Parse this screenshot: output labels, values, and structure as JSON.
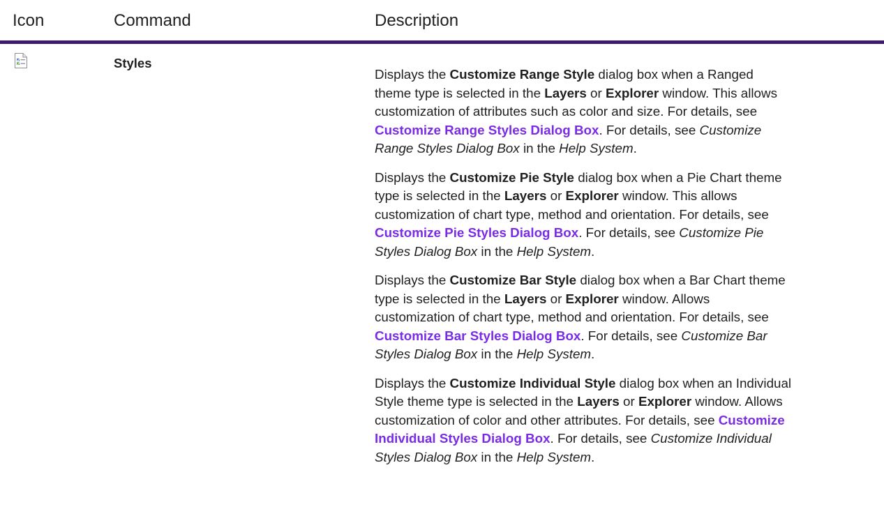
{
  "header": {
    "icon_col": "Icon",
    "command_col": "Command",
    "description_col": "Description"
  },
  "row": {
    "icon": "styles-list-icon",
    "command": "Styles",
    "descriptions": [
      {
        "lines": [
          [
            "Displays the ",
            "Customize Range Style",
            " dialog box when a Ranged"
          ],
          [
            "theme type is selected in the ",
            "Layers",
            " or ",
            "Explorer",
            " window. This allows"
          ],
          [
            "customization of attributes such as color and size. For details, see"
          ],
          [
            "Customize Range Styles Dialog Box",
            ". For details, see ",
            "Customize"
          ],
          [
            "Range Styles Dialog Box",
            " in the ",
            "Help System",
            "."
          ]
        ]
      },
      {
        "lines": [
          [
            "Displays the ",
            "Customize Pie Style",
            " dialog box when a Pie Chart theme"
          ],
          [
            "type is selected in the ",
            "Layers",
            " or ",
            "Explorer",
            " window. This allows"
          ],
          [
            "customization of chart type, method and orientation. For details, see"
          ],
          [
            "Customize Pie Styles Dialog Box",
            ". For details, see ",
            "Customize Pie"
          ],
          [
            "Styles Dialog Box",
            " in the ",
            "Help System",
            "."
          ]
        ]
      },
      {
        "lines": [
          [
            "Displays the ",
            "Customize Bar Style",
            " dialog box when a Bar Chart theme"
          ],
          [
            "type is selected in the ",
            "Layers",
            " or ",
            "Explorer",
            " window. Allows"
          ],
          [
            "customization of chart type, method and orientation. For details, see"
          ],
          [
            "Customize Bar Styles Dialog Box",
            ". For details, see ",
            "Customize Bar"
          ],
          [
            "Styles Dialog Box",
            " in the ",
            "Help System",
            "."
          ]
        ]
      },
      {
        "lines": [
          [
            "Displays the ",
            "Customize Individual Style",
            " dialog box when an Individual"
          ],
          [
            "Style theme type is selected in the ",
            "Layers",
            " or ",
            "Explorer",
            " window. Allows"
          ],
          [
            "customization of  color and other attributes. For details, see ",
            "Customize"
          ],
          [
            "Individual Styles Dialog Box",
            ". For details, see ",
            "Customize Individual"
          ],
          [
            "Styles Dialog Box",
            " in the ",
            "Help System",
            "."
          ]
        ]
      }
    ]
  },
  "colors": {
    "link": "#7a2be6",
    "rule": "#3d1a6e",
    "text": "#1f1f1f"
  }
}
